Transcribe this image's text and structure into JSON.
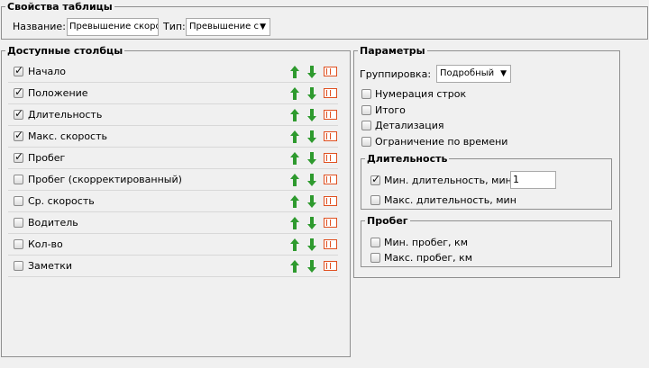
{
  "table_props": {
    "legend": "Свойства таблицы",
    "name_label": "Название:",
    "name_value": "Превышение скорости",
    "type_label": "Тип:",
    "type_value": "Превышение с",
    "dropdown_arrow": "▼"
  },
  "columns": {
    "legend": "Доступные столбцы",
    "items": [
      {
        "label": "Начало",
        "checked": true
      },
      {
        "label": "Положение",
        "checked": true
      },
      {
        "label": "Длительность",
        "checked": true
      },
      {
        "label": "Макс. скорость",
        "checked": true
      },
      {
        "label": "Пробег",
        "checked": true
      },
      {
        "label": "Пробег (скорректированный)",
        "checked": false
      },
      {
        "label": "Ср. скорость",
        "checked": false
      },
      {
        "label": "Водитель",
        "checked": false
      },
      {
        "label": "Кол-во",
        "checked": false
      },
      {
        "label": "Заметки",
        "checked": false
      }
    ],
    "check_glyph": "✓",
    "arrow_color": "#2e9a2e",
    "delete_color": "#e05020"
  },
  "params": {
    "legend": "Параметры",
    "grouping_label": "Группировка:",
    "grouping_value": "Подробный",
    "options": [
      {
        "label": "Нумерация строк",
        "checked": false
      },
      {
        "label": "Итого",
        "checked": false
      },
      {
        "label": "Детализация",
        "checked": false
      },
      {
        "label": "Ограничение по времени",
        "checked": false
      }
    ],
    "duration": {
      "legend": "Длительность",
      "min_label": "Мин. длительность, мин",
      "min_checked": true,
      "min_value": "1",
      "max_label": "Макс. длительность, мин",
      "max_checked": false
    },
    "mileage": {
      "legend": "Пробег",
      "min_label": "Мин. пробег, км",
      "min_checked": false,
      "max_label": "Макс. пробег, км",
      "max_checked": false
    }
  }
}
